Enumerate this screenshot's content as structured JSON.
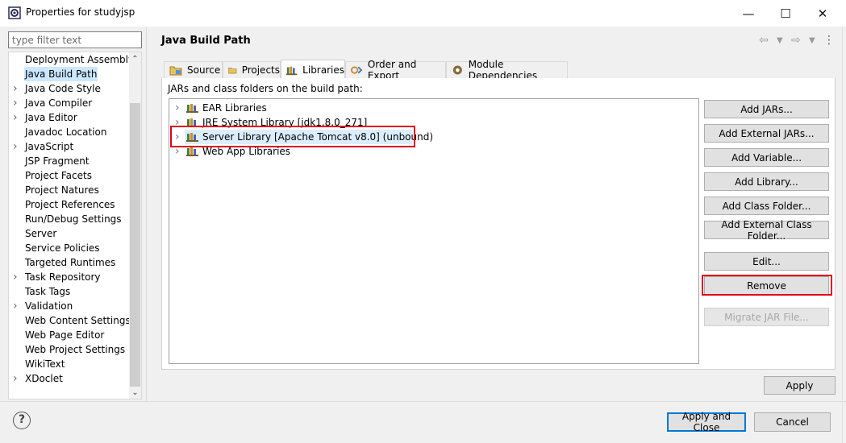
{
  "window": {
    "title": "Properties for studyjsp",
    "minimize_glyph": "—",
    "maximize_glyph": "☐",
    "close_glyph": "✕"
  },
  "filter": {
    "placeholder": "type filter text"
  },
  "tree": {
    "items": [
      {
        "label": "Deployment Assembly",
        "expandable": false
      },
      {
        "label": "Java Build Path",
        "expandable": false,
        "selected": true
      },
      {
        "label": "Java Code Style",
        "expandable": true
      },
      {
        "label": "Java Compiler",
        "expandable": true
      },
      {
        "label": "Java Editor",
        "expandable": true
      },
      {
        "label": "Javadoc Location",
        "expandable": false
      },
      {
        "label": "JavaScript",
        "expandable": true
      },
      {
        "label": "JSP Fragment",
        "expandable": false
      },
      {
        "label": "Project Facets",
        "expandable": false
      },
      {
        "label": "Project Natures",
        "expandable": false
      },
      {
        "label": "Project References",
        "expandable": false
      },
      {
        "label": "Run/Debug Settings",
        "expandable": false
      },
      {
        "label": "Server",
        "expandable": false
      },
      {
        "label": "Service Policies",
        "expandable": false
      },
      {
        "label": "Targeted Runtimes",
        "expandable": false
      },
      {
        "label": "Task Repository",
        "expandable": true
      },
      {
        "label": "Task Tags",
        "expandable": false
      },
      {
        "label": "Validation",
        "expandable": true
      },
      {
        "label": "Web Content Settings",
        "expandable": false
      },
      {
        "label": "Web Page Editor",
        "expandable": false
      },
      {
        "label": "Web Project Settings",
        "expandable": false
      },
      {
        "label": "WikiText",
        "expandable": false
      },
      {
        "label": "XDoclet",
        "expandable": true
      }
    ]
  },
  "page": {
    "title": "Java Build Path",
    "description": "JARs and class folders on the build path:"
  },
  "tabs": [
    {
      "label": "Source",
      "icon": "source-folder-icon"
    },
    {
      "label": "Projects",
      "icon": "projects-folder-icon"
    },
    {
      "label": "Libraries",
      "icon": "libraries-icon",
      "active": true
    },
    {
      "label": "Order and Export",
      "icon": "order-export-icon"
    },
    {
      "label": "Module Dependencies",
      "icon": "module-dependencies-icon"
    }
  ],
  "libraries": [
    {
      "label": "EAR Libraries"
    },
    {
      "label": "JRE System Library [jdk1.8.0_271]"
    },
    {
      "label": "Server Library [Apache Tomcat v8.0] (unbound)",
      "selected": true
    },
    {
      "label": "Web App Libraries"
    }
  ],
  "buttons": {
    "add_jars": "Add JARs...",
    "add_external_jars": "Add External JARs...",
    "add_variable": "Add Variable...",
    "add_library": "Add Library...",
    "add_class_folder": "Add Class Folder...",
    "add_external_class_folder": "Add External Class Folder...",
    "edit": "Edit...",
    "remove": "Remove",
    "migrate_jar": "Migrate JAR File...",
    "apply": "Apply",
    "apply_and_close": "Apply and Close",
    "cancel": "Cancel"
  },
  "colors": {
    "highlight": "#e0001b",
    "selection": "#cce8ff",
    "accent": "#0078d7"
  }
}
